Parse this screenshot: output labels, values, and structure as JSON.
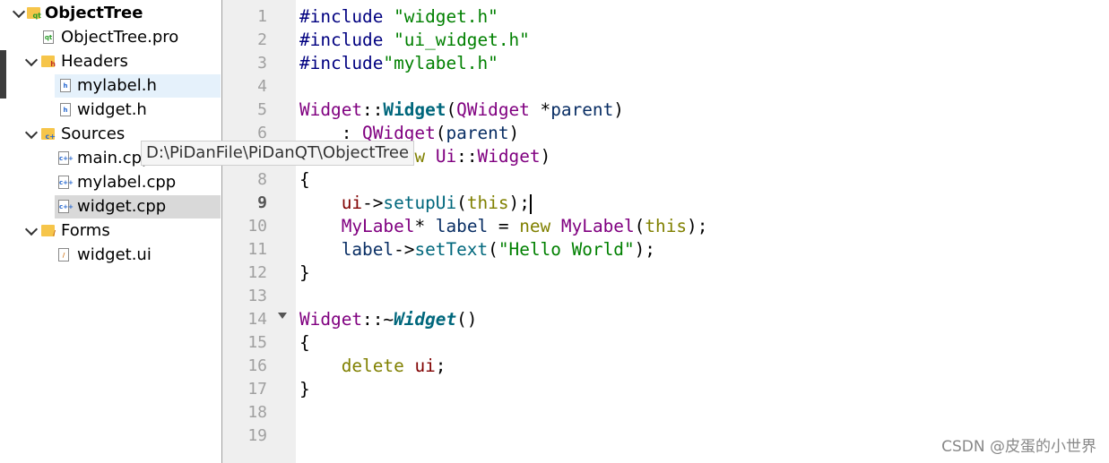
{
  "project_tree": {
    "root": {
      "label": "ObjectTree",
      "icon": "qt-project-folder-icon"
    },
    "items": [
      {
        "label": "ObjectTree.pro",
        "icon": "qt-pro-file-icon",
        "kind": "file"
      },
      {
        "label": "Headers",
        "icon": "headers-folder-icon",
        "kind": "folder",
        "expanded": true
      },
      {
        "label": "mylabel.h",
        "icon": "header-file-icon",
        "kind": "file",
        "state": "hover"
      },
      {
        "label": "widget.h",
        "icon": "header-file-icon",
        "kind": "file"
      },
      {
        "label": "Sources",
        "icon": "sources-folder-icon",
        "kind": "folder",
        "expanded": true
      },
      {
        "label": "main.cpp",
        "icon": "cpp-file-icon",
        "kind": "file"
      },
      {
        "label": "mylabel.cpp",
        "icon": "cpp-file-icon",
        "kind": "file"
      },
      {
        "label": "widget.cpp",
        "icon": "cpp-file-icon",
        "kind": "file",
        "state": "selected"
      },
      {
        "label": "Forms",
        "icon": "forms-folder-icon",
        "kind": "folder",
        "expanded": true
      },
      {
        "label": "widget.ui",
        "icon": "ui-file-icon",
        "kind": "file"
      }
    ]
  },
  "tooltip": {
    "text": "D:\\PiDanFile\\PiDanQT\\ObjectTree"
  },
  "editor": {
    "current_line": 9,
    "line_numbers": [
      "1",
      "2",
      "3",
      "4",
      "5",
      "6",
      "7",
      "8",
      "9",
      "10",
      "11",
      "12",
      "13",
      "14",
      "15",
      "16",
      "17",
      "18",
      "19"
    ],
    "lines": [
      [
        [
          "pp",
          "#include "
        ],
        [
          "str",
          "\"widget.h\""
        ]
      ],
      [
        [
          "pp",
          "#include "
        ],
        [
          "str",
          "\"ui_widget.h\""
        ]
      ],
      [
        [
          "pp",
          "#include"
        ],
        [
          "str",
          "\"mylabel.h\""
        ]
      ],
      [],
      [
        [
          "type",
          "Widget"
        ],
        [
          "plain",
          "::"
        ],
        [
          "fn",
          "Widget"
        ],
        [
          "plain",
          "("
        ],
        [
          "type",
          "QWidget"
        ],
        [
          "plain",
          " *"
        ],
        [
          "var",
          "parent"
        ],
        [
          "plain",
          ")"
        ]
      ],
      [
        [
          "plain",
          "    : "
        ],
        [
          "type",
          "QWidget"
        ],
        [
          "plain",
          "("
        ],
        [
          "var",
          "parent"
        ],
        [
          "plain",
          ")"
        ]
      ],
      [
        [
          "plain",
          "    , "
        ],
        [
          "mem",
          "ui"
        ],
        [
          "plain",
          "("
        ],
        [
          "kw",
          "new"
        ],
        [
          "plain",
          " "
        ],
        [
          "type",
          "Ui"
        ],
        [
          "plain",
          "::"
        ],
        [
          "type",
          "Widget"
        ],
        [
          "plain",
          ")"
        ]
      ],
      [
        [
          "plain",
          "{"
        ]
      ],
      [
        [
          "plain",
          "    "
        ],
        [
          "mem",
          "ui"
        ],
        [
          "plain",
          "->"
        ],
        [
          "call",
          "setupUi"
        ],
        [
          "plain",
          "("
        ],
        [
          "kw",
          "this"
        ],
        [
          "plain",
          ");"
        ]
      ],
      [
        [
          "plain",
          "    "
        ],
        [
          "type",
          "MyLabel"
        ],
        [
          "plain",
          "* "
        ],
        [
          "var",
          "label"
        ],
        [
          "plain",
          " = "
        ],
        [
          "kw",
          "new"
        ],
        [
          "plain",
          " "
        ],
        [
          "type",
          "MyLabel"
        ],
        [
          "plain",
          "("
        ],
        [
          "kw",
          "this"
        ],
        [
          "plain",
          ");"
        ]
      ],
      [
        [
          "plain",
          "    "
        ],
        [
          "var",
          "label"
        ],
        [
          "plain",
          "->"
        ],
        [
          "call",
          "setText"
        ],
        [
          "plain",
          "("
        ],
        [
          "str",
          "\"Hello World\""
        ],
        [
          "plain",
          ");"
        ]
      ],
      [
        [
          "plain",
          "}"
        ]
      ],
      [],
      [
        [
          "type",
          "Widget"
        ],
        [
          "plain",
          "::~"
        ],
        [
          "fni",
          "Widget"
        ],
        [
          "plain",
          "()"
        ]
      ],
      [
        [
          "plain",
          "{"
        ]
      ],
      [
        [
          "plain",
          "    "
        ],
        [
          "kw",
          "delete"
        ],
        [
          "plain",
          " "
        ],
        [
          "mem",
          "ui"
        ],
        [
          "plain",
          ";"
        ]
      ],
      [
        [
          "plain",
          "}"
        ]
      ],
      [],
      []
    ]
  },
  "watermark": "CSDN @皮蛋的小世界",
  "colors": {
    "preprocessor": "#000080",
    "string": "#008000",
    "type": "#800080",
    "function": "#00677c",
    "keyword": "#808000",
    "member": "#800000",
    "selection": "#d9d9d9",
    "hover": "#e5f1fb"
  }
}
